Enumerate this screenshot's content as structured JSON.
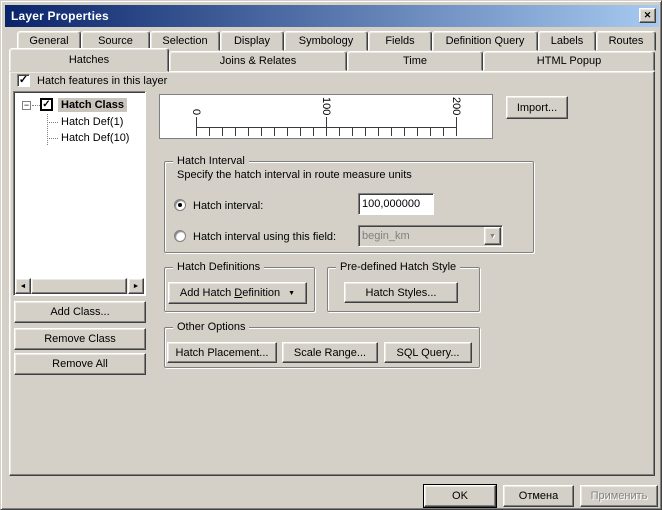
{
  "window": {
    "title": "Layer Properties",
    "close_glyph": "✕"
  },
  "tabs": {
    "row1": [
      "General",
      "Source",
      "Selection",
      "Display",
      "Symbology",
      "Fields",
      "Definition Query",
      "Labels",
      "Routes"
    ],
    "row2": [
      "Hatches",
      "Joins & Relates",
      "Time",
      "HTML Popup"
    ],
    "active_tab": "Hatches"
  },
  "layer_checkbox": {
    "label": "Hatch features in this layer",
    "checked": true,
    "check_glyph": "✓"
  },
  "tree": {
    "root": "Hatch Class",
    "root_checked": true,
    "expander_glyph": "−",
    "check_glyph": "✓",
    "children": [
      "Hatch Def(1)",
      "Hatch Def(10)"
    ]
  },
  "class_buttons": [
    "Add Class...",
    "Remove Class",
    "Remove All"
  ],
  "scrollbar": {
    "left_glyph": "◄",
    "right_glyph": "►"
  },
  "ruler": {
    "labels": [
      "0",
      "100",
      "200"
    ],
    "min": 0,
    "max": 200,
    "minor_step": 10,
    "major_step": 100
  },
  "import_button": "Import...",
  "hatch_interval": {
    "group_title": "Hatch Interval",
    "description": "Specify the hatch interval in route measure units",
    "interval_radio_label": "Hatch interval:",
    "interval_value": "100,000000",
    "field_radio_label": "Hatch interval using this field:",
    "field_value": "begin_km",
    "selected_option": "Hatch interval:"
  },
  "hatch_definitions": {
    "group_title": "Hatch Definitions",
    "add_button_pre": "Add Hatch ",
    "add_button_accel": "D",
    "add_button_post": "efinition",
    "dropdown_glyph": "▼"
  },
  "predefined_style": {
    "group_title": "Pre-defined Hatch Style",
    "styles_button": "Hatch Styles..."
  },
  "other_options": {
    "group_title": "Other Options",
    "buttons": [
      "Hatch Placement...",
      "Scale Range...",
      "SQL Query..."
    ]
  },
  "footer": {
    "ok": "OK",
    "cancel": "Отмена",
    "apply": "Применить",
    "apply_disabled": true
  },
  "colors": {
    "titlebar_left": "#0a246a",
    "titlebar_right": "#a6caf0",
    "dialog_bg": "#d4d0c8",
    "selection_bg": "#c9c5bd",
    "disabled_text": "#808080"
  }
}
